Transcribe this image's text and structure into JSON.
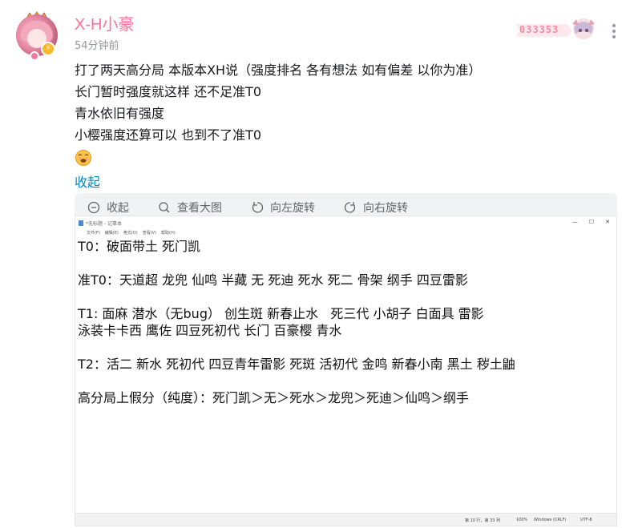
{
  "post": {
    "author": "X-H小豪",
    "time": "54分钟前",
    "fan_number": "033353",
    "lines": [
      "打了两天高分局 本版本XH说（强度排名 各有想法 如有偏差 以你为准）",
      "长门暂时强度就这样 还不足准T0",
      "青水依旧有强度",
      "小樱强度还算可以 也到不了准T0"
    ],
    "collapse_label": "收起"
  },
  "toolbar": {
    "collapse": "收起",
    "view_large": "查看大图",
    "rotate_left": "向左旋转",
    "rotate_right": "向右旋转"
  },
  "notepad": {
    "title": "*无标题 - 记事本",
    "menu": [
      "文件(F)",
      "编辑(E)",
      "格式(O)",
      "查看(V)",
      "帮助(H)"
    ],
    "text_lines": [
      "T0：破面带土 死门凯",
      "",
      "准T0：天道超 龙兜 仙鸣 半藏 无 死迪 死水 死二 骨架 纲手 四豆雷影",
      "",
      "T1: 面麻 潜水（无bug） 创生斑 新春止水   死三代 小胡子 白面具 雷影",
      "泳装卡卡西 鹰佐 四豆死初代 长门 百豪樱 青水",
      "",
      "T2：活二 新水 死初代 四豆青年雷影 死斑 活初代 金鸣 新春小南 黑土 秽土鼬",
      "",
      "高分局上假分（纯度）：死门凯＞无＞死水＞龙兜＞死迪＞仙鸣＞纲手"
    ],
    "status": {
      "position": "第 10 行，第 33 列",
      "zoom": "100%",
      "line_ending": "Windows (CRLF)",
      "encoding": "UTF-8"
    }
  },
  "colors": {
    "username": "#fb7299",
    "link": "#008ac5",
    "toolbar_bg": "#f1f2f3"
  }
}
